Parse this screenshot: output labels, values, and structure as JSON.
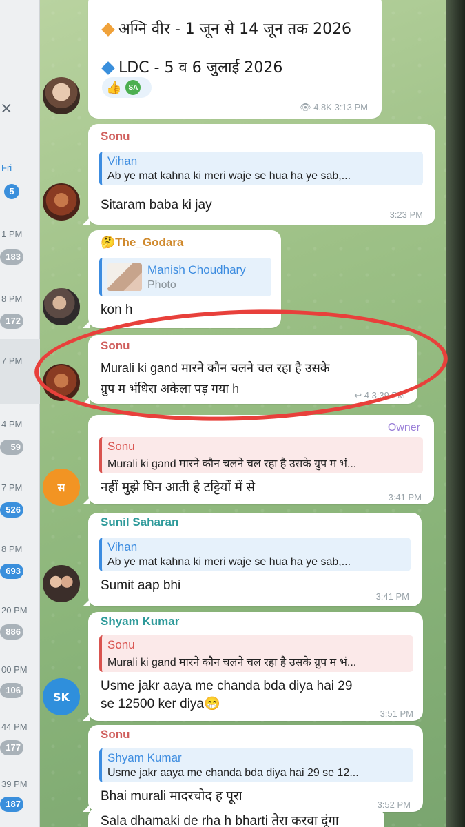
{
  "sidebar": {
    "close_icon": "×",
    "entries": [
      {
        "time": "Fri",
        "badge": "5"
      },
      {
        "time": "1 PM",
        "badge": "183"
      },
      {
        "time": "8 PM",
        "badge": "172"
      },
      {
        "time": "7 PM",
        "badge": ""
      },
      {
        "time": "4 PM",
        "badge": "59"
      },
      {
        "time": "7 PM",
        "badge": "526"
      },
      {
        "time": "8 PM",
        "badge": "693"
      },
      {
        "time": "20 PM",
        "badge": "886"
      },
      {
        "time": "00 PM",
        "badge": "106"
      },
      {
        "time": "44 PM",
        "badge": "177"
      },
      {
        "time": "39 PM",
        "badge": "187"
      }
    ]
  },
  "messages": {
    "post": {
      "line1": "अग्नि वीर - 1 जून से 14 जून तक 2026",
      "line2": "LDC  - 5 व 6 जुलाई 2026",
      "reaction_emoji": "👍",
      "reaction_user": "SA",
      "views": "4.8K",
      "time": "3:13 PM"
    },
    "m1": {
      "sender": "Sonu",
      "reply_name": "Vihan",
      "reply_text": "Ab ye mat kahna ki meri waje se hua ha ye sab,...",
      "text": "Sitaram baba ki jay",
      "time": "3:23 PM"
    },
    "m2": {
      "sender": "🤔The_Godara",
      "reply_name": "Manish Choudhary",
      "reply_text": "Photo",
      "text": "kon h"
    },
    "m3": {
      "sender": "Sonu",
      "text_line1": "Murali ki gand मारने कौन चलने चल रहा है उसके",
      "text_line2": "ग्रुप म भंधिरा अकेला पड़ गया h",
      "meta": "↩ 4 3:39 PM"
    },
    "m4": {
      "owner_tag": "Owner",
      "reply_name": "Sonu",
      "reply_text": "Murali ki gand मारने कौन चलने चल रहा है उसके ग्रुप म भं...",
      "text": "नहीं मुझे घिन आती है टट्टियों में से",
      "time": "3:41 PM",
      "avatar_letter": "स"
    },
    "m5": {
      "sender": "Sunil Saharan",
      "reply_name": "Vihan",
      "reply_text": "Ab ye mat kahna ki meri waje se hua ha ye sab,...",
      "text": "Sumit aap bhi",
      "time": "3:41 PM"
    },
    "m6": {
      "sender": "Shyam Kumar",
      "reply_name": "Sonu",
      "reply_text": "Murali ki gand मारने कौन चलने चल रहा है उसके ग्रुप म भं...",
      "text_line1": "Usme jakr aaya me chanda bda diya hai 29",
      "text_line2": "se 12500 ker diya😁",
      "time": "3:51 PM",
      "avatar_letter": "SK"
    },
    "m7": {
      "sender": "Sonu",
      "reply_name": "Shyam Kumar",
      "reply_text": "Usme jakr aaya me chanda bda diya hai 29 se 12...",
      "text": "Bhai murali  मादरचोद ह पूरा",
      "time": "3:52 PM"
    },
    "m8": {
      "text": "Sala dhamaki de rha h bharti तेरा करवा दूंगा"
    }
  },
  "colors": {
    "highlight_ellipse": "#e8403b",
    "chat_bg": "#9ec187",
    "unread_badge": "#3a8fdc"
  }
}
